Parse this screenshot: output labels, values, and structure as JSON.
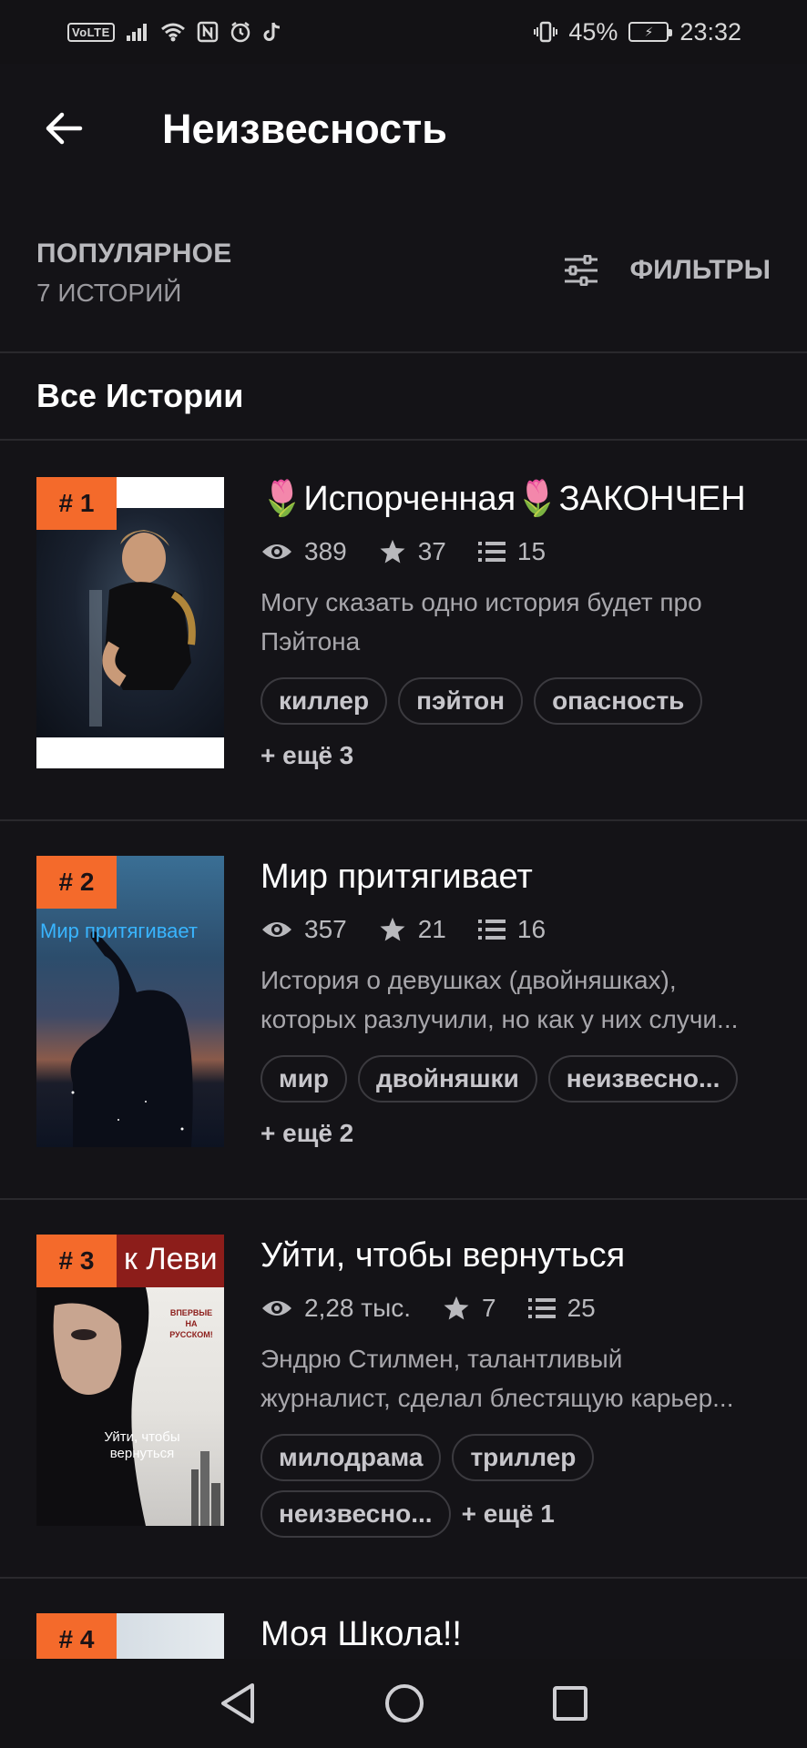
{
  "status_bar": {
    "volte": "VoLTE",
    "battery_percent": "45%",
    "time": "23:32"
  },
  "app_bar": {
    "title": "Неизвесность"
  },
  "section": {
    "kicker": "ПОПУЛЯРНОЕ",
    "count": "7 ИСТОРИЙ",
    "filters_label": "ФИЛЬТРЫ",
    "all_stories": "Все Истории"
  },
  "stories": [
    {
      "rank": "# 1",
      "title": "🌷Испорченная🌷ЗАКОНЧЕН",
      "views": "389",
      "votes": "37",
      "parts": "15",
      "desc_lines": [
        "Могу сказать одно история будет про",
        "Пэйтона"
      ],
      "tags": [
        "киллер",
        "пэйтон",
        "опасность"
      ],
      "more": "+ ещё 3"
    },
    {
      "rank": "# 2",
      "title": "Мир притягивает",
      "views": "357",
      "votes": "21",
      "parts": "16",
      "cover_text": "Мир притягивает",
      "desc_lines": [
        "История о девушках (двойняшках),",
        "которых разлучили, но как у них случи..."
      ],
      "tags": [
        "мир",
        "двойняшки",
        "неизвесно..."
      ],
      "more": "+ ещё 2"
    },
    {
      "rank": "# 3",
      "title": "Уйти, чтобы вернуться",
      "views": "2,28 тыс.",
      "votes": "7",
      "parts": "25",
      "cover_author": "к Леви",
      "cover_badge": "ВПЕРВЫЕ НА РУССКОМ!",
      "cover_title": "Уйти, чтобы вернуться",
      "desc_lines": [
        "Эндрю Стилмен, талантливый",
        "журналист, сделал блестящую карьер..."
      ],
      "tags": [
        "милодрама",
        "триллер",
        "неизвесно..."
      ],
      "more": "+ ещё 1"
    },
    {
      "rank": "# 4",
      "title": "Моя Школа!!"
    }
  ],
  "colors": {
    "background": "#141317",
    "accent": "#f46a2b",
    "muted_text": "#b9b9bd"
  }
}
